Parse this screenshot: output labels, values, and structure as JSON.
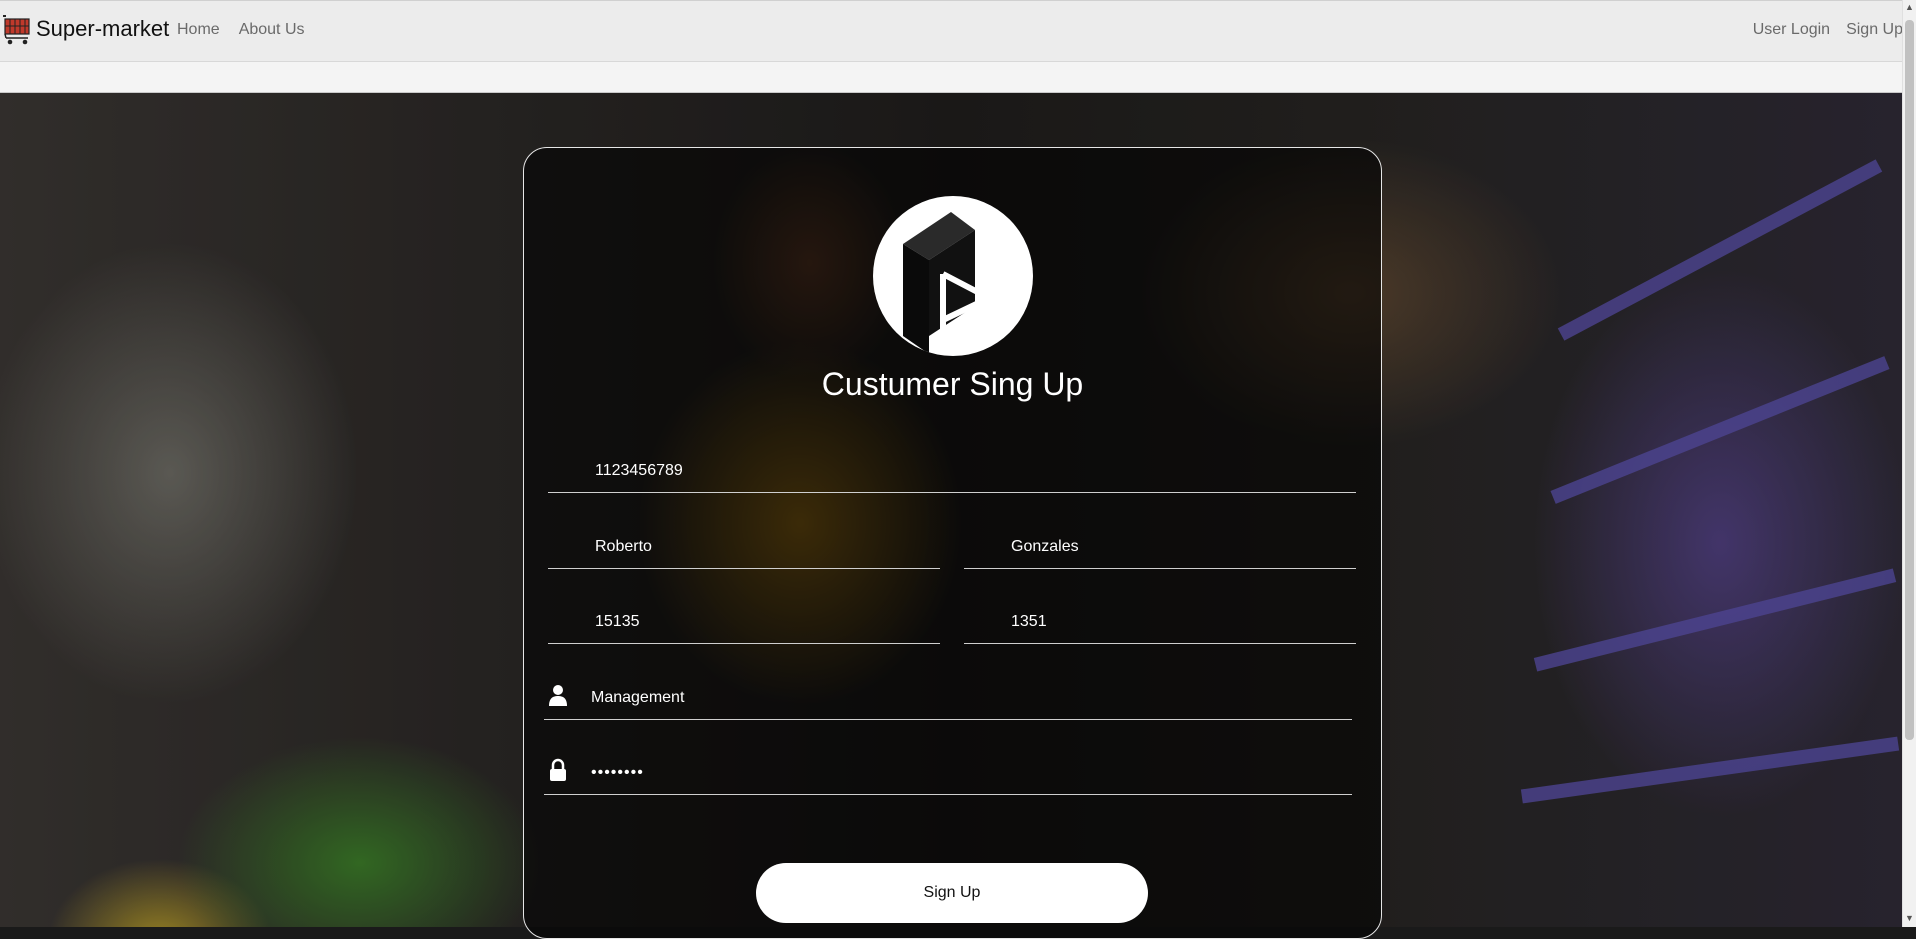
{
  "navbar": {
    "brand": "Super-market",
    "links_left": [
      "Home",
      "About Us"
    ],
    "links_right": [
      "User Login",
      "Sign Up"
    ]
  },
  "form": {
    "title": "Custumer Sing Up",
    "phone": "1123456789",
    "first_name": "Roberto",
    "last_name": "Gonzales",
    "field_a": "15135",
    "field_b": "1351",
    "username": "Management",
    "password": "••••••••",
    "submit": "Sign Up"
  },
  "icons": {
    "brand": "shopping-cart-icon",
    "user": "user-icon",
    "lock": "lock-icon",
    "logo": "box-logo"
  },
  "colors": {
    "navbar_bg": "#ececec",
    "card_border": "#e6e6e6",
    "button_bg": "#ffffff",
    "text_light": "#ffffff"
  }
}
